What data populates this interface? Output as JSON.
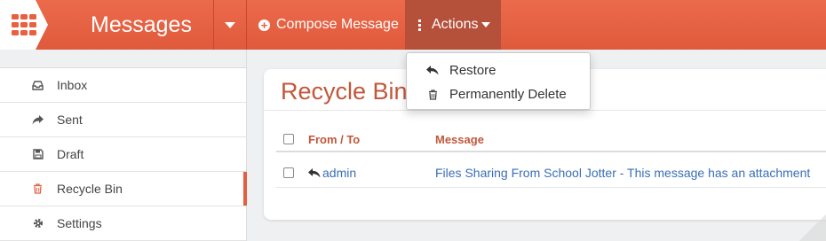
{
  "topbar": {
    "title": "Messages",
    "compose_label": "Compose Message",
    "actions_label": "Actions",
    "accent_color": "#e2603f"
  },
  "actions_menu": {
    "items": [
      {
        "label": "Restore",
        "icon": "reply-icon"
      },
      {
        "label": "Permanently Delete",
        "icon": "trash-icon"
      }
    ]
  },
  "sidebar": {
    "items": [
      {
        "label": "Inbox",
        "icon": "inbox-icon"
      },
      {
        "label": "Sent",
        "icon": "share-icon"
      },
      {
        "label": "Draft",
        "icon": "save-icon"
      },
      {
        "label": "Recycle Bin",
        "icon": "trash-icon",
        "active": true
      },
      {
        "label": "Settings",
        "icon": "gear-icon"
      }
    ]
  },
  "main": {
    "title": "Recycle Bin",
    "table": {
      "columns": [
        "From / To",
        "Message"
      ],
      "rows": [
        {
          "from": "admin",
          "message": "Files Sharing From School Jotter - This message has an attachment"
        }
      ]
    }
  }
}
